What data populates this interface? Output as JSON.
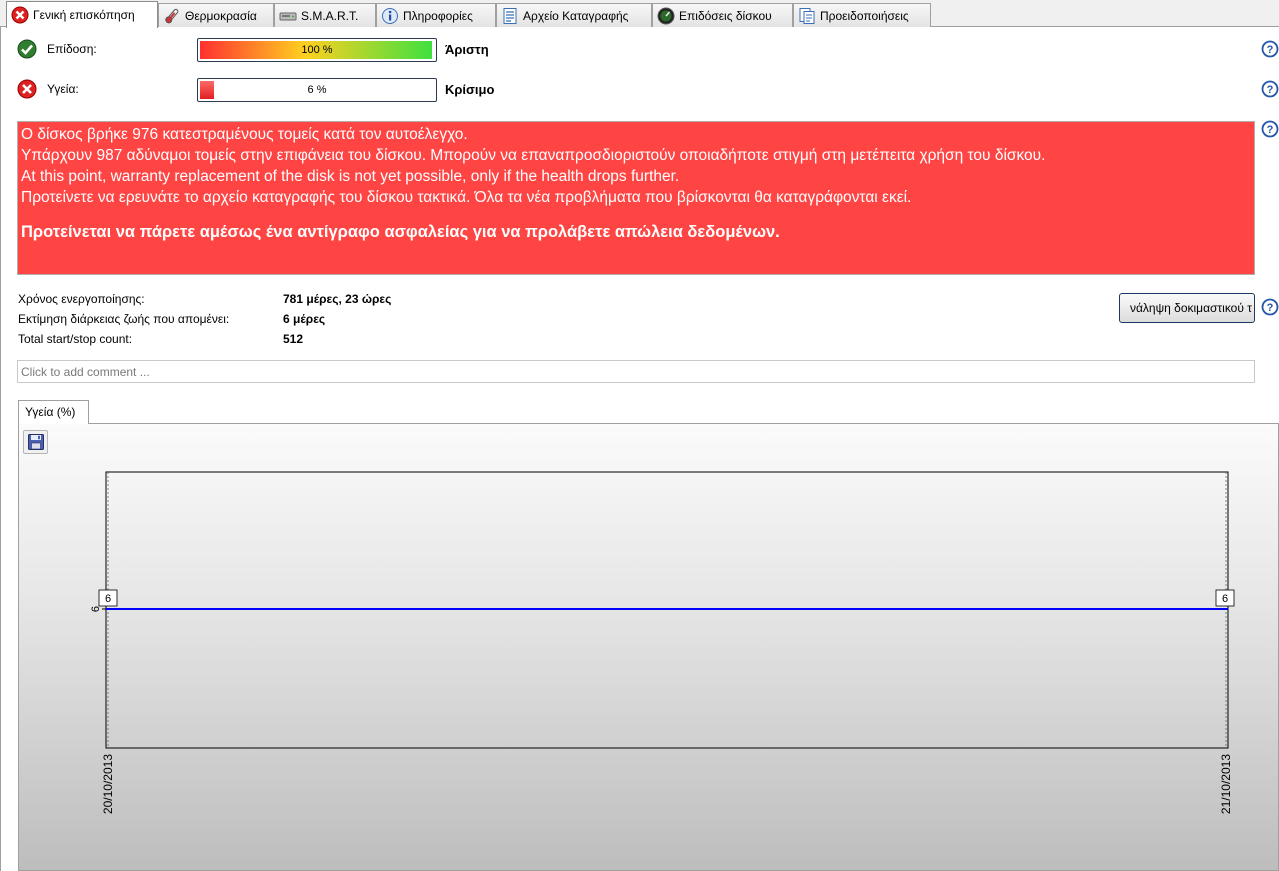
{
  "tabs": [
    {
      "label": "Γενική επισκόπηση",
      "icon": "error-circle-icon",
      "active": true
    },
    {
      "label": "Θερμοκρασία",
      "icon": "thermometer-icon"
    },
    {
      "label": "S.M.A.R.T.",
      "icon": "disk-drive-icon"
    },
    {
      "label": "Πληροφορίες",
      "icon": "info-icon"
    },
    {
      "label": "Αρχείο Καταγραφής",
      "icon": "log-document-icon"
    },
    {
      "label": "Επιδόσεις δίσκου",
      "icon": "gauge-icon"
    },
    {
      "label": "Προειδοποιήσεις",
      "icon": "warning-document-icon"
    }
  ],
  "performance": {
    "label": "Επίδοση:",
    "value_text": "100 %",
    "fraction": 1.0,
    "rating": "Άριστη",
    "status_icon": "check-circle-icon"
  },
  "health": {
    "label": "Υγεία:",
    "value_text": "6 %",
    "fraction": 0.06,
    "rating": "Κρίσιμο",
    "status_icon": "error-circle-icon"
  },
  "alert": {
    "lines": [
      "Ο δίσκος βρήκε 976 κατεστραμένους τομείς κατά τον αυτοέλεγχο.",
      "Υπάρχουν 987 αδύναμοι τομείς στην επιφάνεια του δίσκου. Μπορούν να επαναπροσδιοριστούν οποιαδήποτε στιγμή στη μετέπειτα χρήση του δίσκου.",
      "At this point, warranty replacement of the disk is not yet possible, only if the health drops further.",
      "Προτείνετε να ερευνάτε το αρχείο καταγραφής του δίσκου τακτικά. Όλα τα νέα προβλήματα που βρίσκονται θα καταγράφονται εκεί."
    ],
    "recommendation": "Προτείνεται να πάρετε αμέσως ένα αντίγραφο ασφαλείας για να προλάβετε απώλεια δεδομένων.",
    "background": "#ff4444"
  },
  "stats": [
    {
      "label": "Χρόνος ενεργοποίησης:",
      "value": "781 μέρες, 23 ώρες"
    },
    {
      "label": "Εκτίμηση διάρκειας ζωής που απομένει:",
      "value": "6 μέρες"
    },
    {
      "label": "Total start/stop count:",
      "value": "512"
    }
  ],
  "test_button_label": "νάληψη δοκιμαστικού τ",
  "comment_placeholder": "Click to add comment ...",
  "chart_tab_label": "Υγεία (%)",
  "chart_data": {
    "type": "line",
    "x": [
      "20/10/2013",
      "21/10/2013"
    ],
    "series": [
      {
        "values": [
          6,
          6
        ],
        "color": "#0000ff"
      }
    ],
    "data_labels": [
      "6",
      "6"
    ],
    "y_tick_labels": [
      "6"
    ],
    "ylim": [
      5,
      7
    ],
    "grid": false
  }
}
